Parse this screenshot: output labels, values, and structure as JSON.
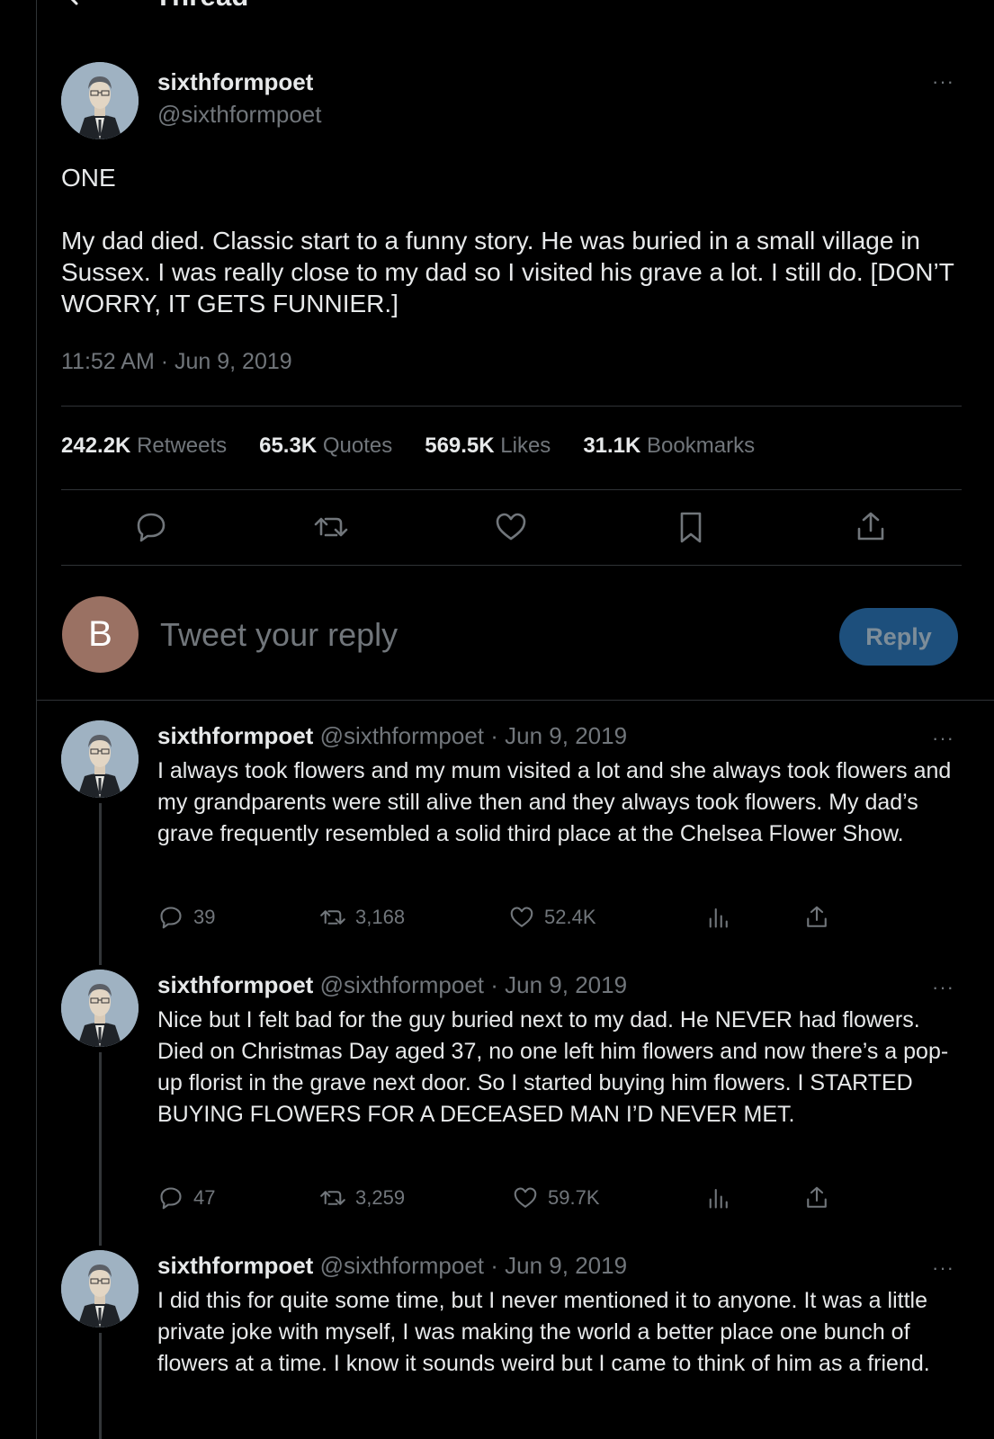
{
  "header": {
    "title": "Thread"
  },
  "main_tweet": {
    "display_name": "sixthformpoet",
    "handle": "@sixthformpoet",
    "text": "ONE\n\nMy dad died. Classic start to a funny story. He was buried in a small village in Sussex. I was really close to my dad so I visited his grave a lot. I still do. [DON’T WORRY, IT GETS FUNNIER.]",
    "timestamp": "11:52 AM · Jun 9, 2019",
    "stats": [
      {
        "value": "242.2K",
        "label": "Retweets"
      },
      {
        "value": "65.3K",
        "label": "Quotes"
      },
      {
        "value": "569.5K",
        "label": "Likes"
      },
      {
        "value": "31.1K",
        "label": "Bookmarks"
      }
    ],
    "more": "···"
  },
  "reply_box": {
    "avatar_letter": "B",
    "placeholder": "Tweet your reply",
    "button_label": "Reply"
  },
  "thread": [
    {
      "display_name": "sixthformpoet",
      "meta": "@sixthformpoet · Jun 9, 2019",
      "text": "I always took flowers and my mum visited a lot and she always took flowers and my grandparents were still alive then and they always took flowers. My dad’s grave frequently resembled a solid third place at the Chelsea Flower Show.",
      "replies": "39",
      "retweets": "3,168",
      "likes": "52.4K",
      "more": "···"
    },
    {
      "display_name": "sixthformpoet",
      "meta": "@sixthformpoet · Jun 9, 2019",
      "text": "Nice but I felt bad for the guy buried next to my dad. He NEVER had flowers. Died on Christmas Day aged 37, no one left him flowers and now there’s a pop-up florist in the grave next door. So I started buying him flowers. I STARTED BUYING FLOWERS FOR A DECEASED MAN I’D NEVER MET.",
      "replies": "47",
      "retweets": "3,259",
      "likes": "59.7K",
      "more": "···"
    },
    {
      "display_name": "sixthformpoet",
      "meta": "@sixthformpoet · Jun 9, 2019",
      "text": "I did this for quite some time, but I never mentioned it to anyone. It was a little private joke with myself, I was making the world a better place one bunch of flowers at a time. I know it sounds weird but I came to think of him as a friend.",
      "more": "···"
    }
  ],
  "colors": {
    "background": "#000000",
    "text": "#e7e9ea",
    "muted": "#71767b",
    "reply_button": "#1d4f7c",
    "divider": "#2f3336"
  }
}
